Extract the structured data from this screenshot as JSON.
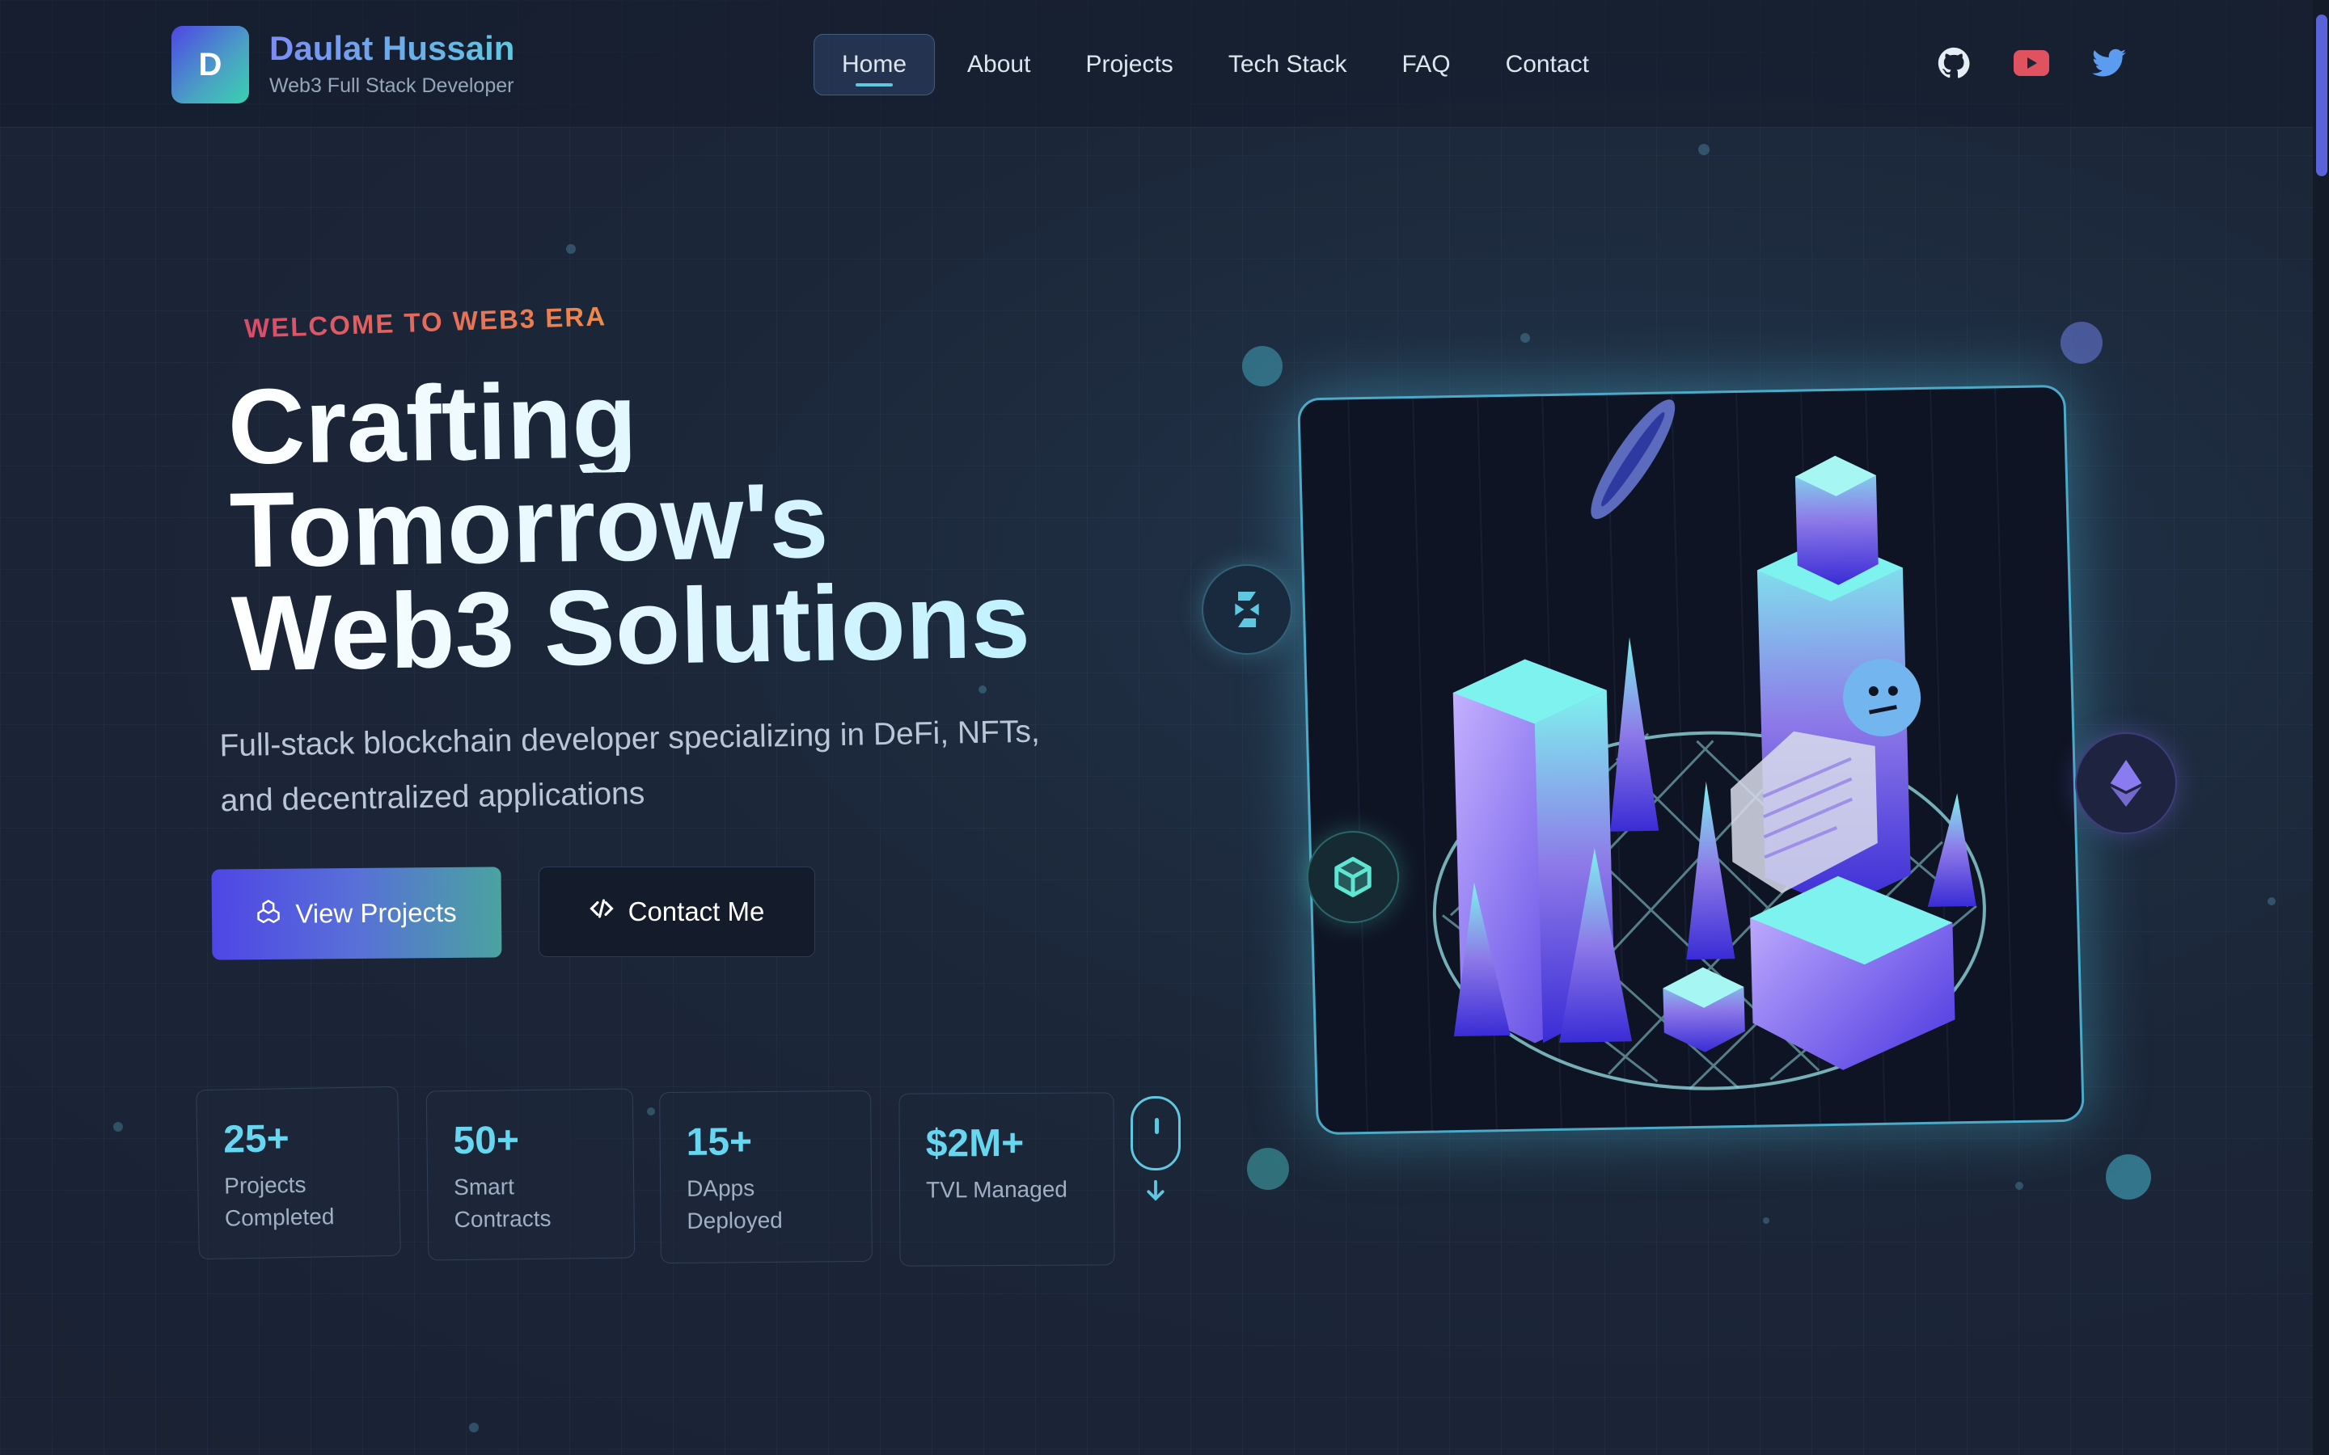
{
  "brand": {
    "logo_letter": "D",
    "name": "Daulat Hussain",
    "tagline": "Web3 Full Stack Developer"
  },
  "nav": {
    "items": [
      "Home",
      "About",
      "Projects",
      "Tech Stack",
      "FAQ",
      "Contact"
    ],
    "active": "Home"
  },
  "social": {
    "icons": [
      "github-icon",
      "youtube-icon",
      "twitter-icon"
    ]
  },
  "hero": {
    "eyebrow": "WELCOME TO WEB3 ERA",
    "headline_lines": [
      "Crafting",
      "Tomorrow's",
      "Web3 Solutions"
    ],
    "subtitle": "Full-stack blockchain developer specializing in DeFi, NFTs, and decentralized applications",
    "primary_button": "View Projects",
    "secondary_button": "Contact Me"
  },
  "stats": [
    {
      "value": "25+",
      "label": "Projects Completed"
    },
    {
      "value": "50+",
      "label": "Smart Contracts"
    },
    {
      "value": "15+",
      "label": "DApps Deployed"
    },
    {
      "value": "$2M+",
      "label": "TVL Managed"
    }
  ],
  "illustration": {
    "floating_icons": [
      "swap-icon",
      "cube-icon",
      "ethereum-icon"
    ]
  },
  "colors": {
    "accent_cyan": "#5fc8e0",
    "accent_indigo": "#4f46e5",
    "eyebrow_red": "#d94b6a",
    "background": "#1b2638"
  }
}
